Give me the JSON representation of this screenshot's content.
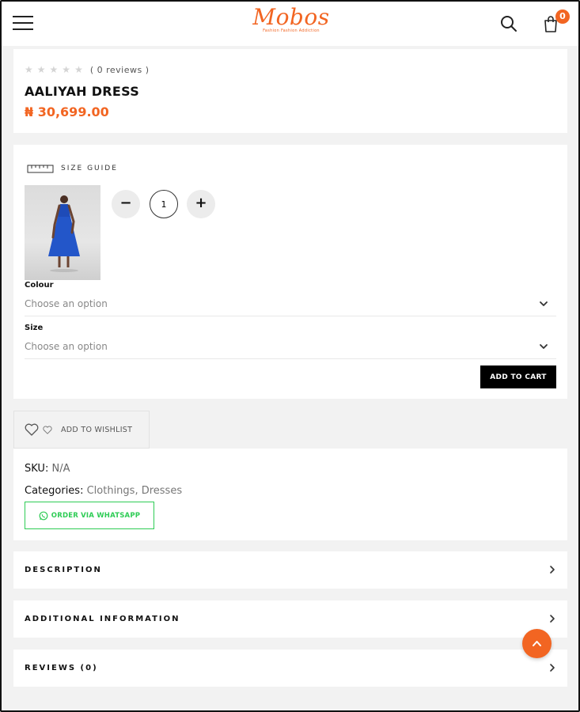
{
  "header": {
    "logo_text": "Mobos",
    "logo_tagline": "Fashion Fashion Addiction",
    "cart_count": "0",
    "icons": [
      "menu-icon",
      "search-icon",
      "shopping-bag-icon"
    ]
  },
  "product": {
    "rating": 0,
    "reviews_label": "( 0 reviews )",
    "title": "AALIYAH DRESS",
    "price": "₦ 30,699.00"
  },
  "options": {
    "size_guide_label": "SIZE GUIDE",
    "quantity": "1",
    "minus_label": "−",
    "plus_label": "+",
    "colour_label": "Colour",
    "colour_value": "Choose an option",
    "size_label": "Size",
    "size_value": "Choose an option",
    "add_to_cart": "ADD TO CART"
  },
  "wishlist": {
    "label": "ADD TO WISHLIST"
  },
  "meta": {
    "sku_label": "SKU:",
    "sku_value": "N/A",
    "categories_label": "Categories:",
    "categories": [
      "Clothings",
      "Dresses"
    ],
    "categories_sep": ", ",
    "whatsapp_label": "ORDER VIA WHATSAPP"
  },
  "accordion": {
    "description": "DESCRIPTION",
    "additional": "ADDITIONAL INFORMATION",
    "reviews": "REVIEWS (0)"
  },
  "colors": {
    "accent": "#f26522",
    "whatsapp": "#2ecc55",
    "button": "#000000",
    "page_bg": "#f2f2f2"
  }
}
